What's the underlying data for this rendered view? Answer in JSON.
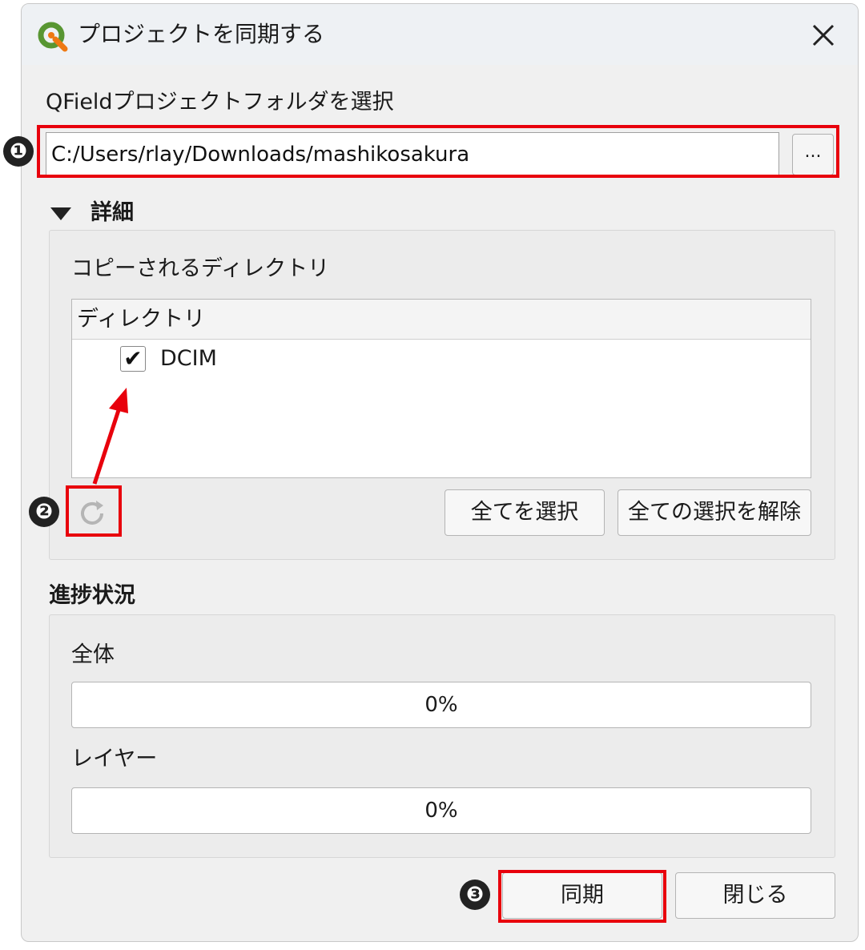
{
  "window": {
    "title": "プロジェクトを同期する",
    "app_icon": "qgis-logo-icon",
    "close_icon": "close-icon"
  },
  "folder": {
    "label": "QFieldプロジェクトフォルダを選択",
    "path": "C:/Users/rlay/Downloads/mashikosakura",
    "browse_label": "..."
  },
  "details": {
    "toggle_label": "詳細",
    "copied_dirs_label": "コピーされるディレクトリ",
    "column_header": "ディレクトリ",
    "items": [
      {
        "label": "DCIM",
        "checked": true
      }
    ],
    "refresh_icon": "refresh-icon",
    "select_all_label": "全てを選択",
    "deselect_all_label": "全ての選択を解除"
  },
  "progress": {
    "section_label": "進捗状況",
    "overall_label": "全体",
    "overall_value": "0%",
    "layer_label": "レイヤー",
    "layer_value": "0%"
  },
  "footer": {
    "sync_label": "同期",
    "close_label": "閉じる"
  },
  "annotations": {
    "marker_1": "❶",
    "marker_2": "❷",
    "marker_3": "❸",
    "highlight_color": "#e8000c",
    "arrow_color": "#e8000c"
  }
}
